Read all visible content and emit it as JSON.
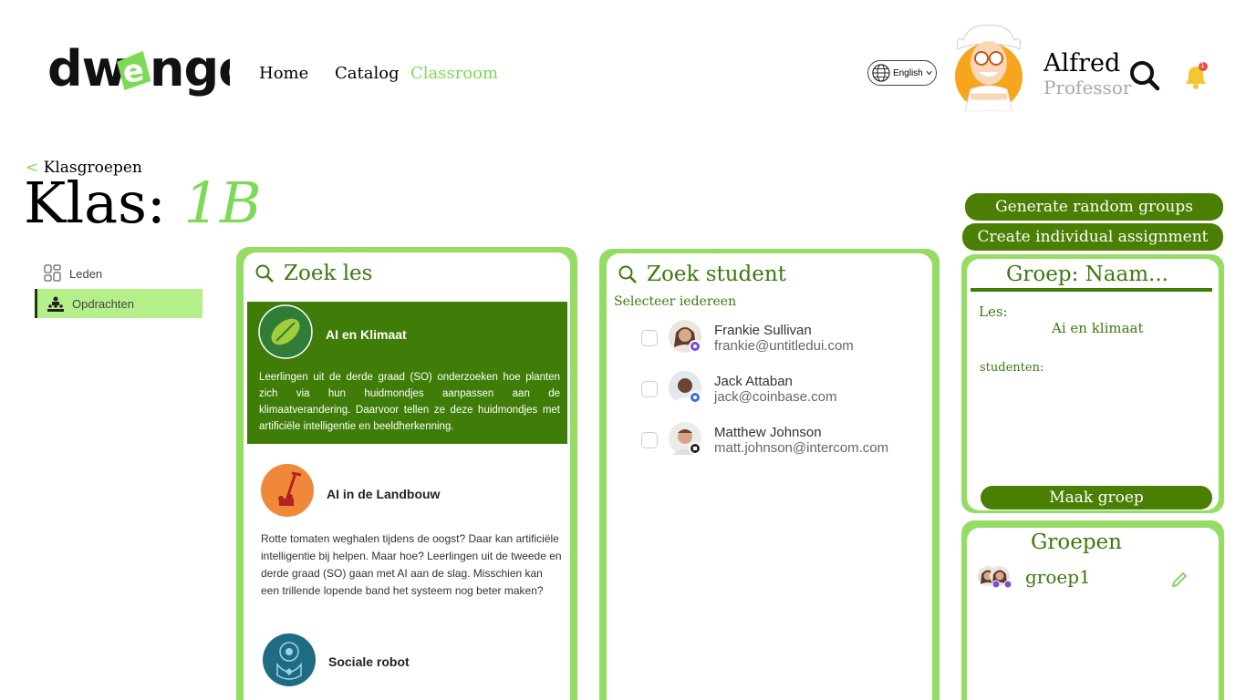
{
  "header": {
    "logo_text": "dwengo",
    "nav": [
      {
        "label": "Home",
        "active": false
      },
      {
        "label": "Catalog",
        "active": false
      },
      {
        "label": "Classroom",
        "active": true
      }
    ],
    "language": "English",
    "user": {
      "name": "Alfred",
      "role": "Professor"
    }
  },
  "breadcrumb": {
    "arrow": "<",
    "label": "Klasgroepen"
  },
  "page_title": {
    "prefix": "Klas:",
    "class_name": "1B"
  },
  "sidebar": {
    "items": [
      {
        "label": "Leden",
        "active": false,
        "icon": "grid-icon"
      },
      {
        "label": "Opdrachten",
        "active": true,
        "icon": "classroom-icon"
      }
    ]
  },
  "lessons_panel": {
    "search_label": "Zoek les",
    "lessons": [
      {
        "title": "AI en Klimaat",
        "description": "Leerlingen uit de derde graad (SO) onderzoeken hoe planten zich via hun huidmondjes aanpassen aan de klimaatverandering. Daarvoor tellen ze deze huidmondjes met artificiële intelligentie en beeldherkenning.",
        "selected": true
      },
      {
        "title": "AI in de Landbouw",
        "description": "Rotte tomaten weghalen tijdens de oogst? Daar kan artificiële intelligentie bij helpen. Maar hoe? Leerlingen uit de tweede en derde graad (SO) gaan met AI aan de slag. Misschien kan een trillende lopende band het systeem nog beter maken?",
        "selected": false
      },
      {
        "title": "Sociale robot",
        "description": "",
        "selected": false
      }
    ]
  },
  "students_panel": {
    "search_label": "Zoek student",
    "select_all_label": "Selecteer iedereen",
    "students": [
      {
        "name": "Frankie Sullivan",
        "email": "frankie@untitledui.com"
      },
      {
        "name": "Jack Attaban",
        "email": "jack@coinbase.com"
      },
      {
        "name": "Matthew Johnson",
        "email": "matt.johnson@intercom.com"
      }
    ]
  },
  "actions": {
    "random_groups": "Generate random groups",
    "individual_assignment": "Create individual assignment"
  },
  "group_editor": {
    "title": "Groep: Naam...",
    "lesson_label": "Les:",
    "lesson_value": "Ai en klimaat",
    "students_label": "studenten:",
    "submit_label": "Maak groep"
  },
  "groups_panel": {
    "title": "Groepen",
    "groups": [
      {
        "name": "groep1"
      }
    ]
  },
  "colors": {
    "accent_light": "#94dc63",
    "accent_dark": "#3f7d08",
    "nav_active": "#7ed957",
    "text_green": "#3c7a0d"
  },
  "notification_count": "1"
}
